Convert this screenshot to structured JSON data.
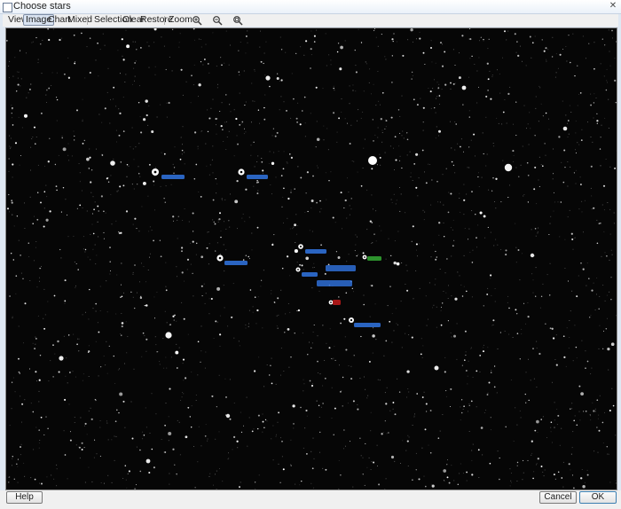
{
  "window": {
    "title": "Choose stars"
  },
  "toolbar": {
    "view": "View",
    "image": "Image",
    "chart": "Chart",
    "mixed": "Mixed",
    "selection": "Selection",
    "clear": "Clear",
    "restore": "Restore",
    "zoom": "Zoom",
    "active_mode": "Image"
  },
  "icons": {
    "zoom_in": "zoom-in-icon",
    "zoom_out": "zoom-out-icon",
    "zoom_fit": "zoom-fit-icon",
    "close": "close-icon"
  },
  "buttons": {
    "help": "Help",
    "cancel": "Cancel",
    "ok": "OK"
  },
  "colors": {
    "comparison_label": "#2f6fd6",
    "check_label": "#2f9a2f",
    "variable_label": "#b01818",
    "sky": "#060606",
    "marker": "#ffffff"
  }
}
